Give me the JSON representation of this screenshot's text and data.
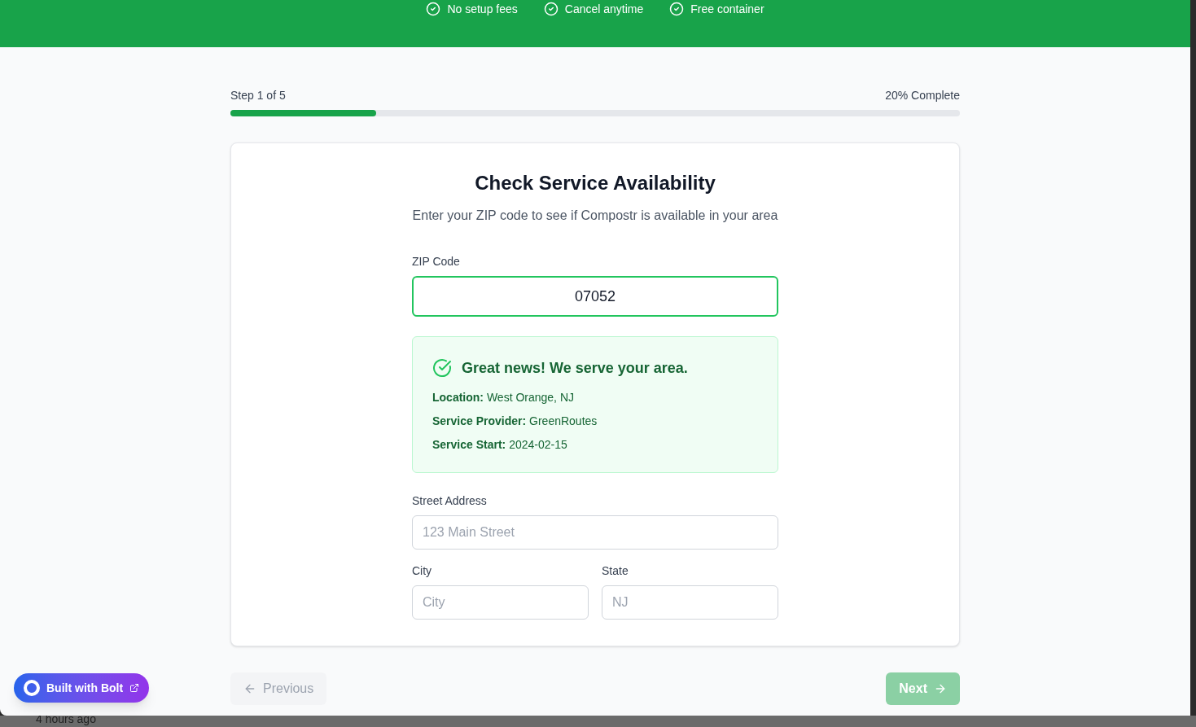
{
  "header": {
    "features": [
      {
        "label": "No setup fees"
      },
      {
        "label": "Cancel anytime"
      },
      {
        "label": "Free container"
      }
    ]
  },
  "progress": {
    "step": "Step 1 of 5",
    "percent": "20% Complete",
    "level": 0.2
  },
  "card": {
    "title": "Check Service Availability",
    "subtitle": "Enter your ZIP code to see if Compostr is available in your area",
    "zip": {
      "label": "ZIP Code",
      "value": "07052",
      "focused": true
    },
    "result": {
      "heading": "Great news! We serve your area.",
      "lines": [
        {
          "label": "Location:",
          "value": "West Orange, NJ"
        },
        {
          "label": "Service Provider:",
          "value": "GreenRoutes"
        },
        {
          "label": "Service Start:",
          "value": "2024-02-15"
        }
      ]
    },
    "street": {
      "label": "Street Address",
      "placeholder": "123 Main Street"
    },
    "city": {
      "label": "City",
      "placeholder": "City"
    },
    "state": {
      "label": "State",
      "placeholder": "NJ"
    }
  },
  "nav": {
    "previous": {
      "label": "Previous",
      "disabled": true
    },
    "next": {
      "label": "Next",
      "disabled": true
    }
  },
  "badge": {
    "label": "Built with Bolt"
  },
  "behind": {
    "text": "4 hours ago"
  }
}
